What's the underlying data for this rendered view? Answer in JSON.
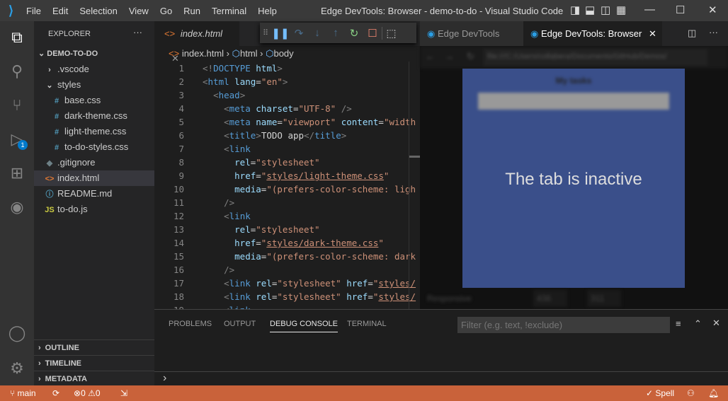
{
  "titlebar": {
    "menu": [
      "File",
      "Edit",
      "Selection",
      "View",
      "Go",
      "Run",
      "Terminal",
      "Help"
    ],
    "title": "Edge DevTools: Browser - demo-to-do - Visual Studio Code"
  },
  "sidebar": {
    "title": "EXPLORER",
    "more": "···",
    "root": "DEMO-TO-DO",
    "items": [
      {
        "label": ".vscode",
        "icon": "chevron-right",
        "indent": 1
      },
      {
        "label": "styles",
        "icon": "chevron-down",
        "indent": 1
      },
      {
        "label": "base.css",
        "icon": "#",
        "indent": 2
      },
      {
        "label": "dark-theme.css",
        "icon": "#",
        "indent": 2
      },
      {
        "label": "light-theme.css",
        "icon": "#",
        "indent": 2
      },
      {
        "label": "to-do-styles.css",
        "icon": "#",
        "indent": 2
      },
      {
        "label": ".gitignore",
        "icon": "◆",
        "indent": 1
      },
      {
        "label": "index.html",
        "icon": "<>",
        "indent": 1,
        "selected": true
      },
      {
        "label": "README.md",
        "icon": "ⓘ",
        "indent": 1
      },
      {
        "label": "to-do.js",
        "icon": "JS",
        "indent": 1
      }
    ],
    "sections": [
      "OUTLINE",
      "TIMELINE",
      "METADATA"
    ]
  },
  "activity": {
    "debug_badge": "1"
  },
  "editor": {
    "tab": "index.html",
    "breadcrumb": [
      "index.html",
      "html",
      "body"
    ],
    "lines": [
      [
        [
          "br",
          "<!"
        ],
        [
          "tag",
          "DOCTYPE"
        ],
        [
          "txt",
          " "
        ],
        [
          "attr",
          "html"
        ],
        [
          "br",
          ">"
        ]
      ],
      [
        [
          "br",
          "<"
        ],
        [
          "tag",
          "html"
        ],
        [
          "txt",
          " "
        ],
        [
          "attr",
          "lang"
        ],
        [
          "txt",
          "="
        ],
        [
          "str",
          "\"en\""
        ],
        [
          "br",
          ">"
        ]
      ],
      [
        [
          "txt",
          "  "
        ],
        [
          "br",
          "<"
        ],
        [
          "tag",
          "head"
        ],
        [
          "br",
          ">"
        ]
      ],
      [
        [
          "txt",
          "    "
        ],
        [
          "br",
          "<"
        ],
        [
          "tag",
          "meta"
        ],
        [
          "txt",
          " "
        ],
        [
          "attr",
          "charset"
        ],
        [
          "txt",
          "="
        ],
        [
          "str",
          "\"UTF-8\""
        ],
        [
          "txt",
          " "
        ],
        [
          "br",
          "/>"
        ]
      ],
      [
        [
          "txt",
          "    "
        ],
        [
          "br",
          "<"
        ],
        [
          "tag",
          "meta"
        ],
        [
          "txt",
          " "
        ],
        [
          "attr",
          "name"
        ],
        [
          "txt",
          "="
        ],
        [
          "str",
          "\"viewport\""
        ],
        [
          "txt",
          " "
        ],
        [
          "attr",
          "content"
        ],
        [
          "txt",
          "="
        ],
        [
          "str",
          "\"width"
        ]
      ],
      [
        [
          "txt",
          "    "
        ],
        [
          "br",
          "<"
        ],
        [
          "tag",
          "title"
        ],
        [
          "br",
          ">"
        ],
        [
          "txt",
          "TODO app"
        ],
        [
          "br",
          "</"
        ],
        [
          "tag",
          "title"
        ],
        [
          "br",
          ">"
        ]
      ],
      [
        [
          "txt",
          "    "
        ],
        [
          "br",
          "<"
        ],
        [
          "tag",
          "link"
        ]
      ],
      [
        [
          "txt",
          "      "
        ],
        [
          "attr",
          "rel"
        ],
        [
          "txt",
          "="
        ],
        [
          "str",
          "\"stylesheet\""
        ]
      ],
      [
        [
          "txt",
          "      "
        ],
        [
          "attr",
          "href"
        ],
        [
          "txt",
          "="
        ],
        [
          "str",
          "\""
        ],
        [
          "u",
          "styles/light-theme.css"
        ],
        [
          "str",
          "\""
        ]
      ],
      [
        [
          "txt",
          "      "
        ],
        [
          "attr",
          "media"
        ],
        [
          "txt",
          "="
        ],
        [
          "str",
          "\"(prefers-color-scheme: ligh"
        ]
      ],
      [
        [
          "txt",
          "    "
        ],
        [
          "br",
          "/>"
        ]
      ],
      [
        [
          "txt",
          "    "
        ],
        [
          "br",
          "<"
        ],
        [
          "tag",
          "link"
        ]
      ],
      [
        [
          "txt",
          "      "
        ],
        [
          "attr",
          "rel"
        ],
        [
          "txt",
          "="
        ],
        [
          "str",
          "\"stylesheet\""
        ]
      ],
      [
        [
          "txt",
          "      "
        ],
        [
          "attr",
          "href"
        ],
        [
          "txt",
          "="
        ],
        [
          "str",
          "\""
        ],
        [
          "u",
          "styles/dark-theme.css"
        ],
        [
          "str",
          "\""
        ]
      ],
      [
        [
          "txt",
          "      "
        ],
        [
          "attr",
          "media"
        ],
        [
          "txt",
          "="
        ],
        [
          "str",
          "\"(prefers-color-scheme: dark"
        ]
      ],
      [
        [
          "txt",
          "    "
        ],
        [
          "br",
          "/>"
        ]
      ],
      [
        [
          "txt",
          "    "
        ],
        [
          "br",
          "<"
        ],
        [
          "tag",
          "link"
        ],
        [
          "txt",
          " "
        ],
        [
          "attr",
          "rel"
        ],
        [
          "txt",
          "="
        ],
        [
          "str",
          "\"stylesheet\""
        ],
        [
          "txt",
          " "
        ],
        [
          "attr",
          "href"
        ],
        [
          "txt",
          "="
        ],
        [
          "str",
          "\""
        ],
        [
          "u",
          "styles/"
        ]
      ],
      [
        [
          "txt",
          "    "
        ],
        [
          "br",
          "<"
        ],
        [
          "tag",
          "link"
        ],
        [
          "txt",
          " "
        ],
        [
          "attr",
          "rel"
        ],
        [
          "txt",
          "="
        ],
        [
          "str",
          "\"stylesheet\""
        ],
        [
          "txt",
          " "
        ],
        [
          "attr",
          "href"
        ],
        [
          "txt",
          "="
        ],
        [
          "str",
          "\""
        ],
        [
          "u",
          "styles/"
        ]
      ],
      [
        [
          "txt",
          "    "
        ],
        [
          "br",
          "<"
        ],
        [
          "tag",
          "link"
        ]
      ]
    ]
  },
  "devtools": {
    "tabs": [
      "Edge DevTools",
      "Edge DevTools: Browser"
    ],
    "url": "file:///C:/Users/collabera/Documents/GitHub/Demos/",
    "page_title": "My tasks",
    "inactive_message": "The tab is inactive",
    "device": "Responsive",
    "width": "436",
    "height": "311"
  },
  "panel": {
    "tabs": [
      "PROBLEMS",
      "OUTPUT",
      "DEBUG CONSOLE",
      "TERMINAL"
    ],
    "active_tab": "DEBUG CONSOLE",
    "filter_placeholder": "Filter (e.g. text, !exclude)",
    "prompt": "›"
  },
  "status": {
    "branch": "main",
    "errors": "0",
    "warnings": "0",
    "spell": "Spell"
  },
  "colors": {
    "status_bar": "#c9623a",
    "accent": "#007acc"
  }
}
